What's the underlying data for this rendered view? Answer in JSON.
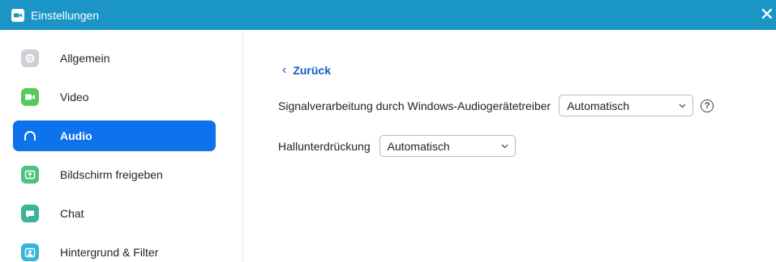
{
  "window": {
    "title": "Einstellungen",
    "close_symbol": "✕",
    "accent_color": "#1a95c6"
  },
  "sidebar": {
    "items": [
      {
        "label": "Allgemein",
        "icon": "gear-icon",
        "color": "#cfd0d6",
        "active": false
      },
      {
        "label": "Video",
        "icon": "video-camera-icon",
        "color": "#57c85a",
        "active": false
      },
      {
        "label": "Audio",
        "icon": "headphones-icon",
        "color": "#0e72ed",
        "active": true
      },
      {
        "label": "Bildschirm freigeben",
        "icon": "share-screen-icon",
        "color": "#4cc281",
        "active": false
      },
      {
        "label": "Chat",
        "icon": "chat-bubble-icon",
        "color": "#3bb59a",
        "active": false
      },
      {
        "label": "Hintergrund & Filter",
        "icon": "person-background-icon",
        "color": "#36b5d6",
        "active": false
      }
    ]
  },
  "content": {
    "back_label": "Zurück",
    "back_chevron": "‹",
    "signal_processing": {
      "label": "Signalverarbeitung durch Windows-Audiogerätetreiber",
      "value": "Automatisch"
    },
    "echo_cancellation": {
      "label": "Hallunterdrückung",
      "value": "Automatisch"
    },
    "help_symbol": "?"
  }
}
